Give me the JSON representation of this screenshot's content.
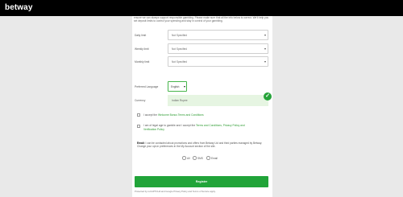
{
  "brand": {
    "logo": "betway"
  },
  "intro": "ensure we can always support responsible gambling. Please make sure that all the info below is correct. We'll help you set deposit limits to control your spending and stay in control of your gambling.",
  "limits": [
    {
      "label": "Daily limit",
      "value": "Not Specified"
    },
    {
      "label": "Weekly limit",
      "value": "Not Specified"
    },
    {
      "label": "Monthly limit",
      "value": "Not Specified"
    }
  ],
  "language": {
    "label": "Preferred Language",
    "value": "English"
  },
  "currency": {
    "label": "Currency",
    "value": "Indian Rupee"
  },
  "consents": [
    {
      "pre": "I accept the ",
      "link": "Welcome Bonus Terms and Conditions",
      "post": ""
    },
    {
      "pre": "I am of legal age to gamble and I accept the ",
      "link": "Terms and Conditions, Privacy Policy and Verification Policy",
      "post": ""
    }
  ],
  "email": {
    "bold": "Email:",
    "text": " I can be contacted about promotions and offers from Betway Ltd and third parties managed by Betway. Change your opt-in preferences in the My Account section of the site.",
    "options": [
      "All",
      "SMS",
      "Email"
    ]
  },
  "register": {
    "label": "Register"
  },
  "footnote": "Protected by reCAPTCHA and Google Privacy Policy and Terms of Service apply."
}
